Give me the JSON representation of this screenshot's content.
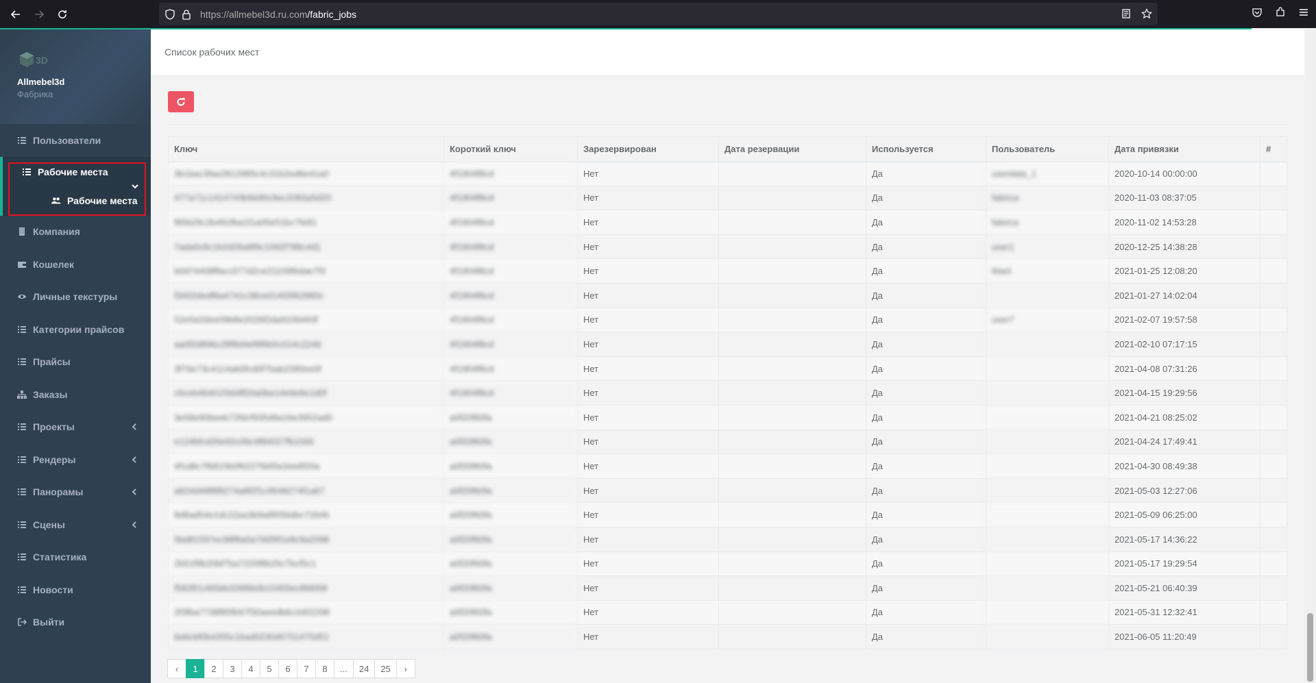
{
  "browser": {
    "url_host": "https://allmebel3d.ru.com",
    "url_path": "/fabric_jobs"
  },
  "sidebar": {
    "brand": "Allmebel3d",
    "brand_sub": "Фабрика",
    "items": [
      {
        "label": "Пользователи",
        "icon": "list-icon"
      },
      {
        "label": "Рабочие места",
        "icon": "list-icon",
        "sub": "Рабочие места"
      },
      {
        "label": "Компания",
        "icon": "building-icon"
      },
      {
        "label": "Кошелек",
        "icon": "wallet-icon"
      },
      {
        "label": "Личные текстуры",
        "icon": "eye-icon"
      },
      {
        "label": "Категории прайсов",
        "icon": "list-icon"
      },
      {
        "label": "Прайсы",
        "icon": "list-icon"
      },
      {
        "label": "Заказы",
        "icon": "sitemap-icon"
      },
      {
        "label": "Проекты",
        "icon": "list-icon"
      },
      {
        "label": "Рендеры",
        "icon": "list-icon"
      },
      {
        "label": "Панорамы",
        "icon": "list-icon"
      },
      {
        "label": "Сцены",
        "icon": "list-icon"
      },
      {
        "label": "Статистика",
        "icon": "list-icon"
      },
      {
        "label": "Новости",
        "icon": "list-icon"
      },
      {
        "label": "Выйти",
        "icon": "sign-out-icon"
      }
    ]
  },
  "page": {
    "title": "Список рабочих мест"
  },
  "table": {
    "headers": [
      "Ключ",
      "Короткий ключ",
      "Зарезервирован",
      "Дата резервации",
      "Используется",
      "Пользователь",
      "Дата привязки",
      "#"
    ],
    "rows": [
      [
        "3b1bac3faa2812985c4c31b2ed6e41a0",
        "4f1904f8cd",
        "Нет",
        "",
        "Да",
        "userdata_1",
        "2020-10-14 00:00:00",
        ""
      ],
      [
        "477a71c1414743b9e90c9ec2093a5d20",
        "4f1904f8cd",
        "Нет",
        "",
        "Да",
        "fabrica",
        "2020-11-03 08:37:05",
        ""
      ],
      [
        "f85b29c2b491fba1f1a05e51bc7fe81",
        "4f1904f8cd",
        "Нет",
        "",
        "Да",
        "fabrica",
        "2020-11-02 14:53:28",
        ""
      ],
      [
        "7ada0c8c1b2d28a8f9c1092f788c4d1",
        "4f1904f8cd",
        "Нет",
        "",
        "Да",
        "user1",
        "2020-12-25 14:38:28",
        ""
      ],
      [
        "b0d74408ffacc077d2ce21109f6dae7f3",
        "4f1904f8cd",
        "Нет",
        "",
        "Да",
        "Manl",
        "2021-01-25 12:08:20",
        ""
      ],
      [
        "f3402dedf8a4741c38ce01455f62880c",
        "4f1904f8cd",
        "Нет",
        "",
        "Да",
        "",
        "2021-01-27 14:02:04",
        ""
      ],
      [
        "52e5a33ee09b8e2026f2da9106493f",
        "4f1904f8cd",
        "Нет",
        "",
        "Да",
        "user7",
        "2021-02-07 19:57:58",
        ""
      ],
      [
        "aa0f2d896c28f8d4ef9f6b5c014c2246",
        "4f1904f8cd",
        "Нет",
        "",
        "Да",
        "",
        "2021-02-10 07:17:15",
        ""
      ],
      [
        "3f76e73c4114ab0fcd0f7bab2280ee0f",
        "4f1904f8cd",
        "Нет",
        "",
        "Да",
        "",
        "2021-04-08 07:31:26",
        ""
      ],
      [
        "c6ceb46401f3d4ff20a0be14e9e8e1d0f",
        "4f1904f8cd",
        "Нет",
        "",
        "Да",
        "",
        "2021-04-15 19:29:56",
        ""
      ],
      [
        "3e58e90beeb72fdcf935d9a16e3952ad0",
        "a0f20f60fa",
        "Нет",
        "",
        "Да",
        "",
        "2021-04-21 08:25:02",
        ""
      ],
      [
        "e124bfcd26e92c06c9f84027fb1566",
        "a0f20f60fa",
        "Нет",
        "",
        "Да",
        "",
        "2021-04-24 17:49:41",
        ""
      ],
      [
        "4f1d8c7f6815b0f6227fd45e2ee8f20a",
        "a0f20f60fa",
        "Нет",
        "",
        "Да",
        "",
        "2021-04-30 08:49:38",
        ""
      ],
      [
        "a824d49f8f8274a8f2f1c9549274f1a67",
        "a0f20f60fa",
        "Нет",
        "",
        "Да",
        "",
        "2021-05-03 12:27:06",
        ""
      ],
      [
        "8d8ad54e1dc22aa3b9a8f05bdbc72646",
        "a0f20f60fa",
        "Нет",
        "",
        "Да",
        "",
        "2021-05-09 06:25:00",
        ""
      ],
      [
        "5bd81597ec98f8a0a766f9f1e8c9a2098",
        "a0f20f60fa",
        "Нет",
        "",
        "Да",
        "",
        "2021-05-17 14:36:22",
        ""
      ],
      [
        "2b51f9b20bf7ba7225f8b25c7bcf5c1",
        "a0f20f60fa",
        "Нет",
        "",
        "Да",
        "",
        "2021-05-17 19:29:54",
        ""
      ],
      [
        "f582f01465bb326f6b0b15455ec8fd058",
        "a0f20f60fa",
        "Нет",
        "",
        "Да",
        "",
        "2021-05-21 06:40:39",
        ""
      ],
      [
        "2f3fba7738f85fb97f30aeedb6c2d02298",
        "a0f20f60fa",
        "Нет",
        "",
        "Да",
        "",
        "2021-05-31 12:32:41",
        ""
      ],
      [
        "6a6cbf0b4355c1bad0230d0751475d51",
        "a0f20f60fa",
        "Нет",
        "",
        "Да",
        "",
        "2021-06-05 11:20:49",
        ""
      ]
    ]
  },
  "pagination": {
    "prev": "‹",
    "pages": [
      "1",
      "2",
      "3",
      "4",
      "5",
      "6",
      "7",
      "8",
      "...",
      "24",
      "25"
    ],
    "next": "›",
    "active": "1"
  },
  "colors": {
    "sidebar": "#2f4050",
    "accent": "#1ab394",
    "danger": "#ed5565",
    "highlight": "#e0141e"
  }
}
